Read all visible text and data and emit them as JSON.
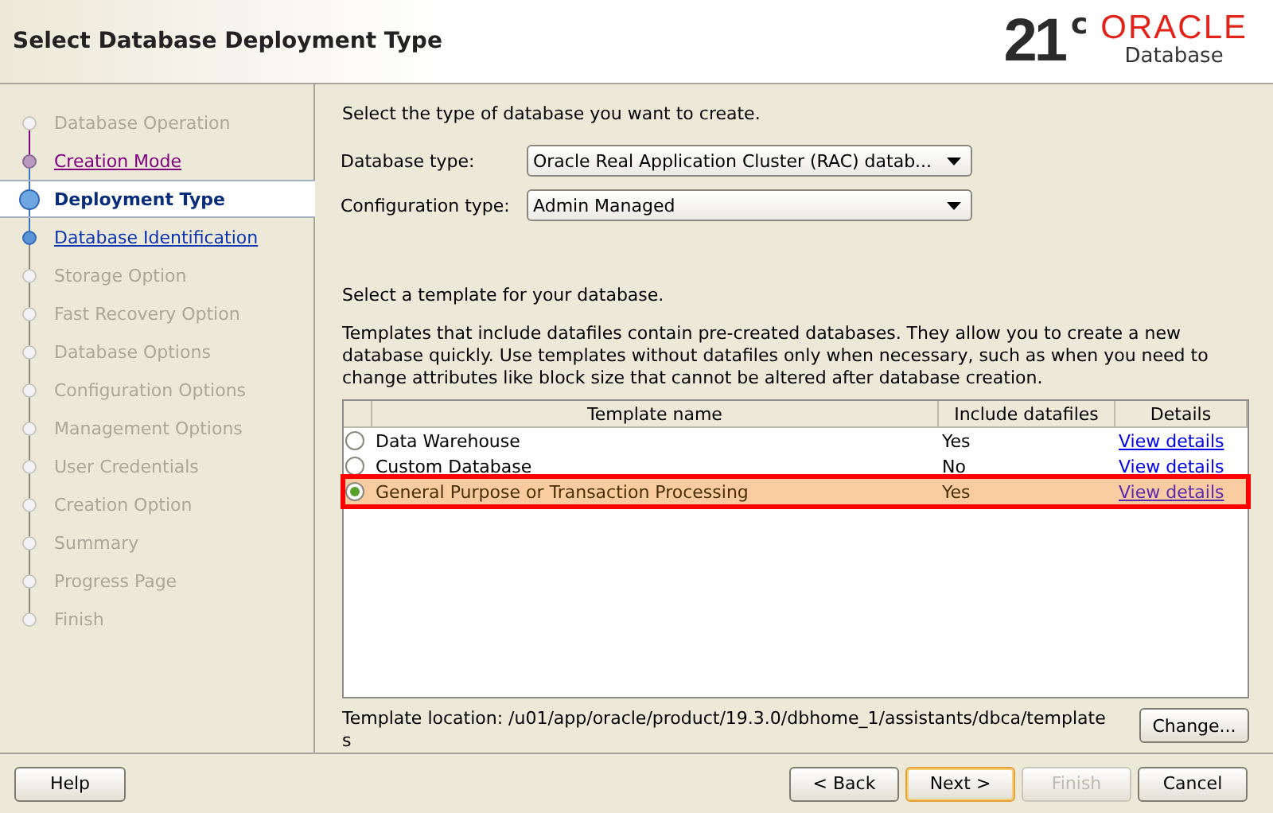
{
  "window": {
    "title": "Select Database Deployment Type"
  },
  "logo": {
    "version": "21",
    "superscript": "c",
    "brand": "ORACLE",
    "product": "Database"
  },
  "steps": [
    {
      "label": "Database Operation",
      "kind": "disabled"
    },
    {
      "label": "Creation Mode",
      "kind": "visited"
    },
    {
      "label": "Deployment Type",
      "kind": "current"
    },
    {
      "label": "Database Identification",
      "kind": "link"
    },
    {
      "label": "Storage Option",
      "kind": "disabled"
    },
    {
      "label": "Fast Recovery Option",
      "kind": "disabled"
    },
    {
      "label": "Database Options",
      "kind": "disabled"
    },
    {
      "label": "Configuration Options",
      "kind": "disabled"
    },
    {
      "label": "Management Options",
      "kind": "disabled"
    },
    {
      "label": "User Credentials",
      "kind": "disabled"
    },
    {
      "label": "Creation Option",
      "kind": "disabled"
    },
    {
      "label": "Summary",
      "kind": "disabled"
    },
    {
      "label": "Progress Page",
      "kind": "disabled"
    },
    {
      "label": "Finish",
      "kind": "disabled"
    }
  ],
  "intro": "Select the type of database you want to create.",
  "fields": [
    {
      "label": "Database type:",
      "value": "Oracle Real Application Cluster (RAC) datab..."
    },
    {
      "label": "Configuration type:",
      "value": "Admin Managed"
    }
  ],
  "template_prompt": "Select a template for your database.",
  "template_note": "Templates that include datafiles contain pre-created databases. They allow you to create a new database quickly. Use templates without datafiles only when necessary, such as when you need to change attributes like block size that cannot be altered after database creation.",
  "table": {
    "columns": [
      "Template name",
      "Include datafiles",
      "Details"
    ],
    "rows": [
      {
        "name": "Data Warehouse",
        "datafiles": "Yes",
        "details": "View details",
        "selected": false,
        "highlighted": false
      },
      {
        "name": "Custom Database",
        "datafiles": "No",
        "details": "View details",
        "selected": false,
        "highlighted": false
      },
      {
        "name": "General Purpose or Transaction Processing",
        "datafiles": "Yes",
        "details": "View details",
        "selected": true,
        "highlighted": true
      }
    ]
  },
  "template_location": "Template location: /u01/app/oracle/product/19.3.0/dbhome_1/assistants/dbca/templates",
  "change_button": "Change...",
  "help_button": "Help",
  "nav_buttons": [
    {
      "label": "< Back",
      "disabled": false,
      "default": false
    },
    {
      "label": "Next >",
      "disabled": false,
      "default": true
    },
    {
      "label": "Finish",
      "disabled": true,
      "default": false
    },
    {
      "label": "Cancel",
      "disabled": false,
      "default": false
    }
  ]
}
